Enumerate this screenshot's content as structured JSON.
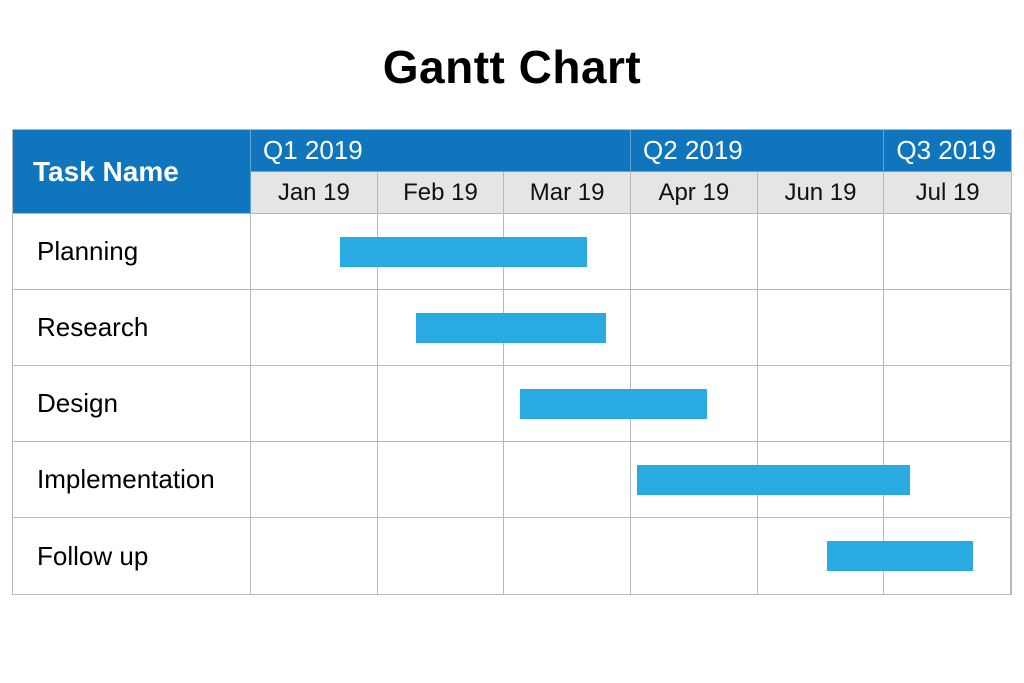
{
  "title": "Gantt Chart",
  "header": {
    "task_name_label": "Task Name",
    "quarters": [
      {
        "label": "Q1 2019",
        "span_months": 3
      },
      {
        "label": "Q2 2019",
        "span_months": 2
      },
      {
        "label": "Q3 2019",
        "span_months": 1
      }
    ],
    "months": [
      "Jan 19",
      "Feb 19",
      "Mar 19",
      "Apr 19",
      "Jun 19",
      "Jul 19"
    ]
  },
  "tasks": [
    {
      "name": "Planning",
      "start": 0.7,
      "end": 2.65
    },
    {
      "name": "Research",
      "start": 1.3,
      "end": 2.8
    },
    {
      "name": "Design",
      "start": 2.12,
      "end": 3.6
    },
    {
      "name": "Implementation",
      "start": 3.05,
      "end": 5.2
    },
    {
      "name": "Follow up",
      "start": 4.55,
      "end": 5.7
    }
  ],
  "colors": {
    "header_bg": "#0f75bc",
    "month_bg": "#e5e5e5",
    "bar": "#29abe2",
    "grid": "#b9b9b9"
  },
  "chart_data": {
    "type": "bar",
    "title": "Gantt Chart",
    "xlabel": "",
    "ylabel": "Task Name",
    "x_categories": [
      "Jan 19",
      "Feb 19",
      "Mar 19",
      "Apr 19",
      "Jun 19",
      "Jul 19"
    ],
    "x_groups": [
      {
        "label": "Q1 2019",
        "members": [
          "Jan 19",
          "Feb 19",
          "Mar 19"
        ]
      },
      {
        "label": "Q2 2019",
        "members": [
          "Apr 19",
          "Jun 19"
        ]
      },
      {
        "label": "Q3 2019",
        "members": [
          "Jul 19"
        ]
      }
    ],
    "xlim": [
      0,
      6
    ],
    "series": [
      {
        "name": "Planning",
        "range": [
          0.7,
          2.65
        ]
      },
      {
        "name": "Research",
        "range": [
          1.3,
          2.8
        ]
      },
      {
        "name": "Design",
        "range": [
          2.12,
          3.6
        ]
      },
      {
        "name": "Implementation",
        "range": [
          3.05,
          5.2
        ]
      },
      {
        "name": "Follow up",
        "range": [
          4.55,
          5.7
        ]
      }
    ],
    "notes": "Ranges are in month-index units where 0 = left edge of Jan 19 column and 6 = right edge of Jul 19 column. Endpoints estimated from bar positions relative to month gridlines."
  }
}
